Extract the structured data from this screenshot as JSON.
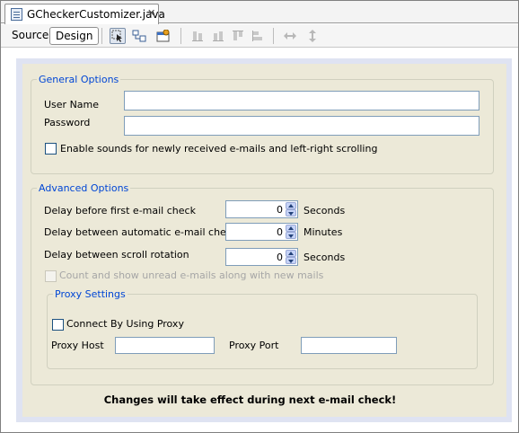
{
  "tab": {
    "title": "GCheckerCustomizer.java",
    "close_glyph": "✕",
    "icon": "java-file-icon"
  },
  "toolbar": {
    "source_label": "Source",
    "design_label": "Design",
    "icons": [
      "selection-mode-icon",
      "connection-mode-icon",
      "preview-design-icon",
      "align-left-icon",
      "align-right-icon",
      "align-top-icon",
      "align-bottom-icon",
      "resize-horizontal-icon",
      "resize-vertical-icon"
    ]
  },
  "general": {
    "title": "General Options",
    "username_label": "User Name",
    "username_value": "",
    "password_label": "Password",
    "password_value": "",
    "sounds_label": "Enable sounds for newly received e-mails and left-right scrolling",
    "sounds_checked": false
  },
  "advanced": {
    "title": "Advanced Options",
    "delay_first_label": "Delay before first e-mail check",
    "delay_first_value": "0",
    "delay_first_unit": "Seconds",
    "delay_auto_label": "Delay between automatic e-mail checks",
    "delay_auto_value": "0",
    "delay_auto_unit": "Minutes",
    "delay_scroll_label": "Delay between scroll rotation",
    "delay_scroll_value": "0",
    "delay_scroll_unit": "Seconds",
    "count_unread_label": "Count and show unread e-mails along with new mails",
    "count_unread_checked": false
  },
  "proxy": {
    "title": "Proxy Settings",
    "use_proxy_label": "Connect By Using Proxy",
    "use_proxy_checked": false,
    "host_label": "Proxy Host",
    "host_value": "",
    "port_label": "Proxy Port",
    "port_value": ""
  },
  "notice": "Changes will take effect during next e-mail check!",
  "colors": {
    "group_title": "#0046d5",
    "panel_bg": "#ece9d8",
    "canvas_border": "#dfe3f2"
  }
}
